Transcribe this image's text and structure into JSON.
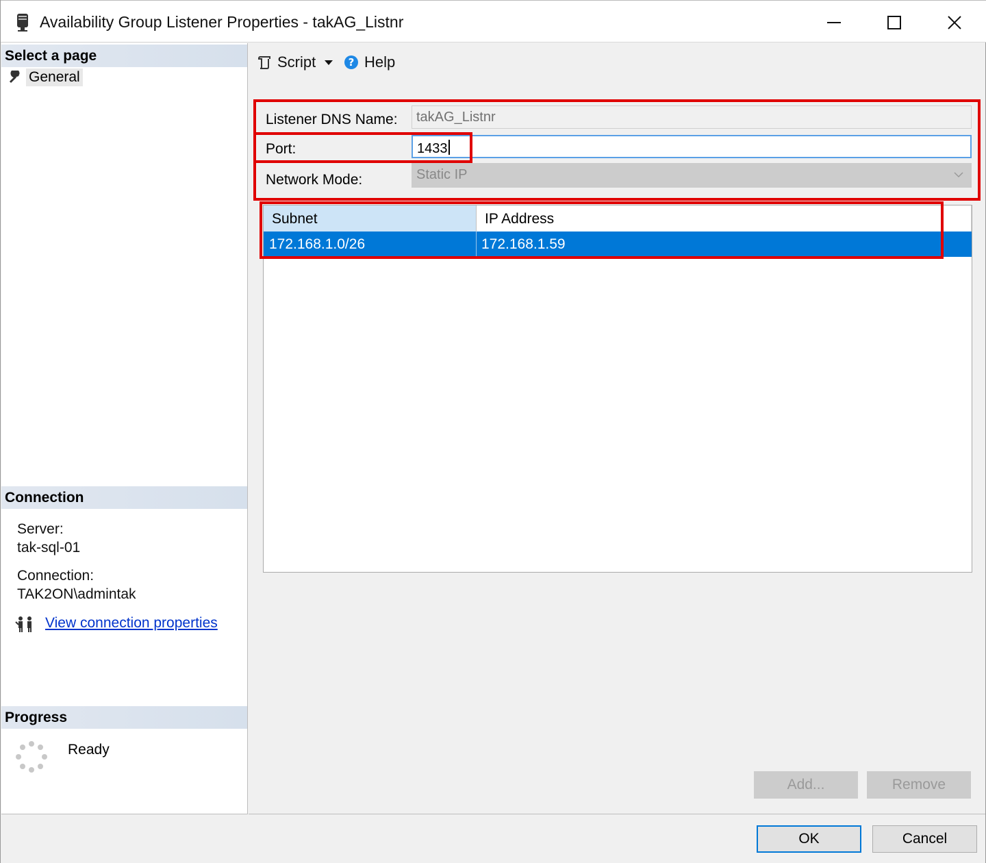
{
  "window": {
    "title": "Availability Group Listener Properties - takAG_Listnr",
    "controls": [
      "minimize-icon",
      "maximize-icon",
      "close-icon"
    ]
  },
  "left_pane": {
    "select_page": {
      "header": "Select a page",
      "items": [
        {
          "label": "General",
          "icon": "wrench-icon"
        }
      ]
    },
    "connection": {
      "header": "Connection",
      "server_label": "Server:",
      "server_value": "tak-sql-01",
      "connection_label": "Connection:",
      "connection_value": "TAK2ON\\admintak",
      "view_link": "View connection properties"
    },
    "progress": {
      "header": "Progress",
      "status": "Ready"
    }
  },
  "toolbar": {
    "script_label": "Script",
    "help_label": "Help"
  },
  "form": {
    "dns_label": "Listener DNS Name:",
    "dns_value": "takAG_Listnr",
    "port_label": "Port:",
    "port_value": "1433",
    "mode_label": "Network Mode:",
    "mode_value": "Static IP"
  },
  "grid": {
    "columns": [
      "Subnet",
      "IP Address"
    ],
    "rows": [
      {
        "subnet": "172.168.1.0/26",
        "ip": "172.168.1.59",
        "selected": true
      }
    ]
  },
  "buttons": {
    "add": "Add...",
    "remove": "Remove",
    "ok": "OK",
    "cancel": "Cancel"
  },
  "colors": {
    "selection": "#0078d7",
    "highlight_box": "#e00000",
    "link": "#0033cc",
    "section_header": "#d6e0ec"
  }
}
